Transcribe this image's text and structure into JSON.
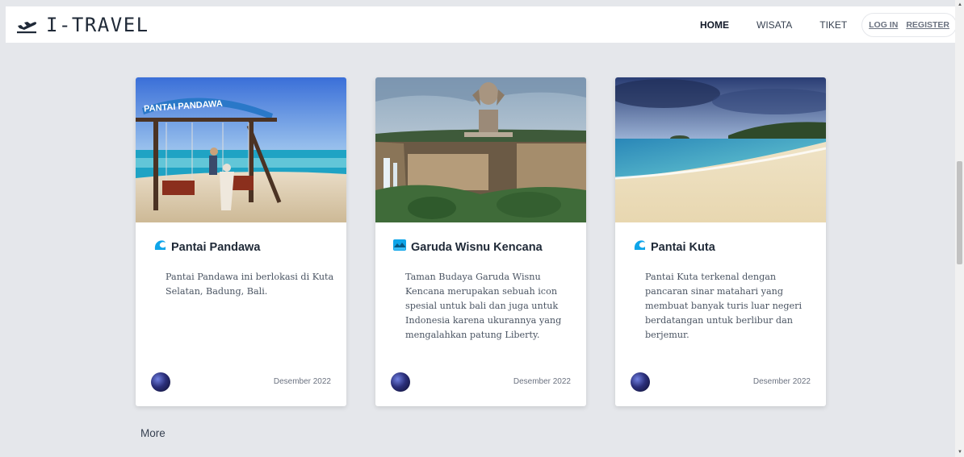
{
  "brand": {
    "name": "I-TRAVEL",
    "icon": "plane-departure-icon"
  },
  "nav": {
    "home": "HOME",
    "wisata": "WISATA",
    "tiket": "TIKET",
    "active": "HOME"
  },
  "auth": {
    "login": "LOG IN",
    "register": "REGISTER"
  },
  "cards": [
    {
      "title": "Pantai Pandawa",
      "icon": "wave-icon",
      "image_sign_text": "PANTAI PANDAWA",
      "description": "Pantai Pandawa ini berlokasi di Kuta Selatan, Badung, Bali.",
      "date": "Desember 2022"
    },
    {
      "title": "Garuda Wisnu Kencana",
      "icon": "mountain-lake-icon",
      "description": "Taman Budaya Garuda Wisnu Kencana merupakan sebuah icon spesial untuk bali dan juga untuk Indonesia karena ukurannya yang mengalahkan patung Liberty.",
      "date": "Desember 2022"
    },
    {
      "title": "Pantai Kuta",
      "icon": "wave-icon",
      "description": "Pantai Kuta terkenal dengan pancaran sinar matahari yang membuat banyak turis luar negeri berdatangan untuk berlibur dan berjemur.",
      "date": "Desember 2022"
    }
  ],
  "more": "More",
  "colors": {
    "background": "#e5e7eb",
    "card": "#ffffff",
    "icon_blue": "#0ea5e9"
  }
}
